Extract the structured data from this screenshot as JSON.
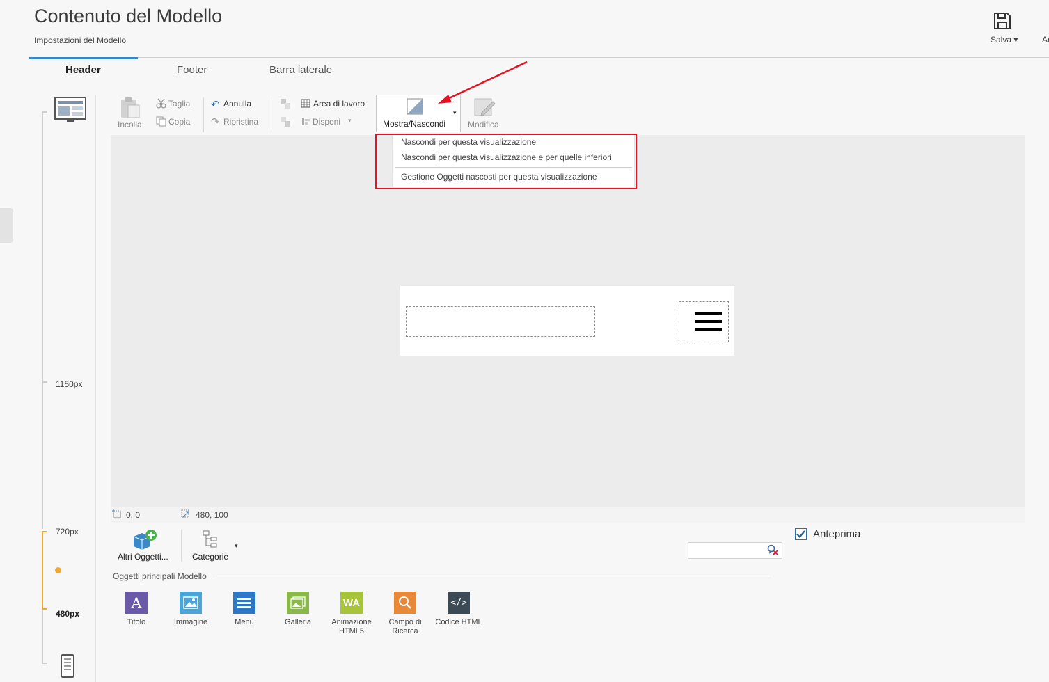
{
  "header": {
    "title": "Contenuto del Modello",
    "subtitle": "Impostazioni del Modello",
    "save_label": "Salva ▾",
    "cut_label": "Ar"
  },
  "tabs": [
    {
      "label": "Header",
      "active": true
    },
    {
      "label": "Footer",
      "active": false
    },
    {
      "label": "Barra laterale",
      "active": false
    }
  ],
  "ruler": {
    "bp1": "1150px",
    "bp2": "720px",
    "bp3": "480px"
  },
  "toolbar": {
    "paste": "Incolla",
    "cut": "Taglia",
    "copy": "Copia",
    "undo": "Annulla",
    "redo": "Ripristina",
    "workarea": "Area di lavoro",
    "arrange": "Disponi",
    "show_hide": "Mostra/Nascondi",
    "edit": "Modifica"
  },
  "dropdown": {
    "items": [
      "Nascondi per questa visualizzazione",
      "Nascondi per questa visualizzazione e per quelle inferiori",
      "Gestione Oggetti nascosti per questa visualizzazione"
    ]
  },
  "status": {
    "position": "0, 0",
    "size": "480, 100"
  },
  "lower": {
    "other_objects": "Altri Oggetti...",
    "categories": "Categorie",
    "preview_label": "Anteprima",
    "preview_checked": true,
    "section_title": "Oggetti principali Modello",
    "objects": [
      {
        "label": "Titolo",
        "color": "#6b5aa8",
        "icon": "title-icon"
      },
      {
        "label": "Immagine",
        "color": "#4aa6d8",
        "icon": "image-icon"
      },
      {
        "label": "Menu",
        "color": "#2a78c7",
        "icon": "menu-icon"
      },
      {
        "label": "Galleria",
        "color": "#8ab94a",
        "icon": "gallery-icon"
      },
      {
        "label": "Animazione HTML5",
        "color": "#a8c43a",
        "icon": "html5-animation-icon"
      },
      {
        "label": "Campo di Ricerca",
        "color": "#e8893a",
        "icon": "search-field-icon"
      },
      {
        "label": "Codice HTML",
        "color": "#3b4a55",
        "icon": "html-code-icon"
      }
    ]
  },
  "colors": {
    "accent": "#3b88c8",
    "highlight": "#e81123",
    "breakpoint": "#f0a830"
  }
}
